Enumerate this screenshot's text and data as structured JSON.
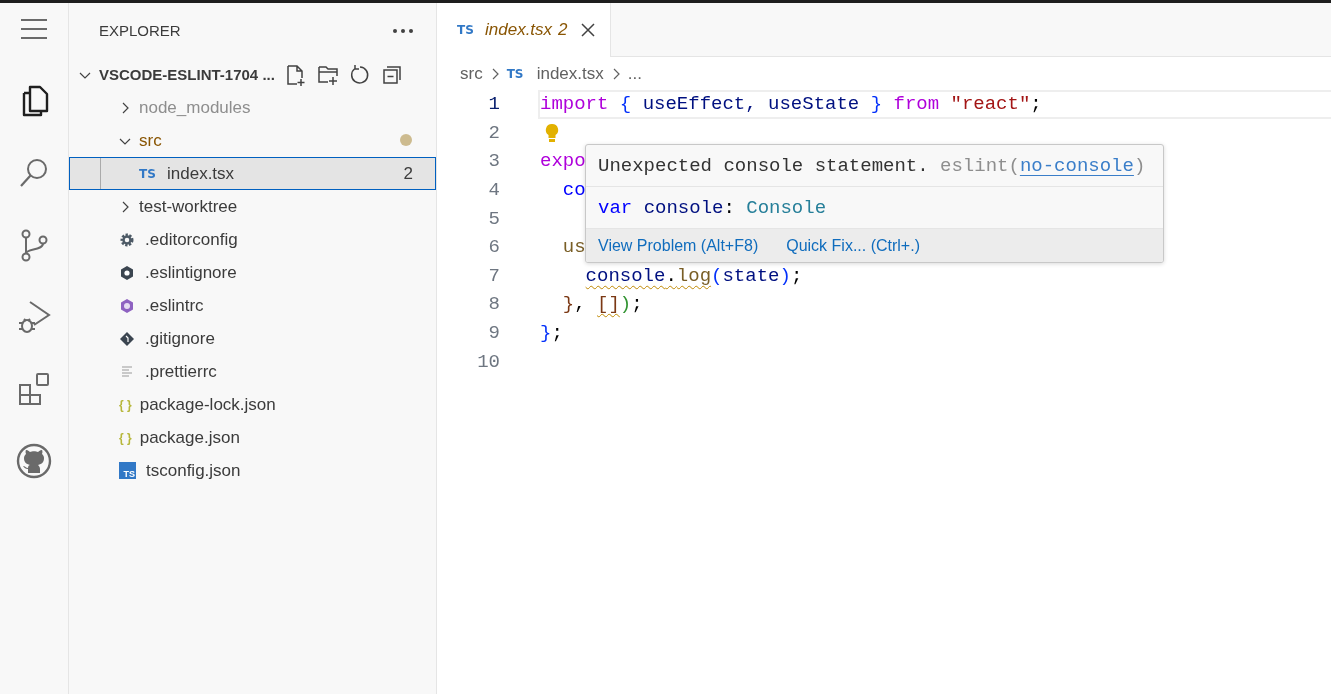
{
  "activity_bar": [
    {
      "kind": "menu",
      "selected": false
    },
    {
      "kind": "files",
      "selected": true
    },
    {
      "kind": "search",
      "selected": false
    },
    {
      "kind": "source-control",
      "selected": false
    },
    {
      "kind": "run-debug",
      "selected": false
    },
    {
      "kind": "extensions",
      "selected": false
    },
    {
      "kind": "github",
      "selected": false
    }
  ],
  "sidebar": {
    "title": "EXPLORER",
    "root": {
      "label": "VSCODE-ESLINT-1704 ...",
      "expanded": true,
      "children": [
        {
          "label": "node_modules",
          "kind": "folder",
          "expanded": false,
          "ignored": true,
          "modified": false,
          "selected": false
        },
        {
          "label": "src",
          "kind": "folder",
          "expanded": true,
          "ignored": false,
          "modified": true,
          "selected": false,
          "children": [
            {
              "label": "index.tsx",
              "kind": "ts",
              "icon_label": "TS",
              "problems": "2",
              "selected": true
            }
          ]
        },
        {
          "label": "test-worktree",
          "kind": "folder",
          "expanded": false,
          "ignored": false,
          "modified": false,
          "selected": false
        },
        {
          "label": ".editorconfig",
          "kind": "gear",
          "selected": false
        },
        {
          "label": ".eslintignore",
          "kind": "hexagon-dark",
          "selected": false
        },
        {
          "label": ".eslintrc",
          "kind": "hexagon-purple",
          "selected": false
        },
        {
          "label": ".gitignore",
          "kind": "diamond",
          "selected": false
        },
        {
          "label": ".prettierrc",
          "kind": "lines",
          "selected": false
        },
        {
          "label": "package-lock.json",
          "kind": "json",
          "icon_label": "{ }",
          "selected": false
        },
        {
          "label": "package.json",
          "kind": "json",
          "icon_label": "{ }",
          "selected": false
        },
        {
          "label": "tsconfig.json",
          "kind": "ts-box",
          "icon_label": "TS",
          "selected": false
        }
      ]
    }
  },
  "editor": {
    "tabs": [
      {
        "icon_label": "TS",
        "label": "index.tsx",
        "problems": "2",
        "selected": true,
        "preview": true
      }
    ],
    "breadcrumb": [
      {
        "label": "src"
      },
      {
        "icon_label": "TS",
        "label": "index.tsx"
      },
      {
        "label": "..."
      }
    ],
    "lines": [
      {
        "number": "1",
        "active": true,
        "tokens": [
          {
            "text": "import",
            "kind": "keyword"
          },
          {
            "text": " {",
            "kind": "brace"
          },
          {
            "text": " useEffect, useState",
            "kind": "variable"
          },
          {
            "text": " }",
            "kind": "brace"
          },
          {
            "text": " from",
            "kind": "keyword"
          },
          {
            "text": " \"react\"",
            "kind": "string"
          },
          {
            "text": ";",
            "kind": "plain"
          }
        ]
      },
      {
        "number": "2",
        "active": false,
        "lightbulb": true
      },
      {
        "number": "3",
        "active": false,
        "tokens": [
          {
            "text": "expo",
            "kind": "keyword"
          }
        ]
      },
      {
        "number": "4",
        "active": false,
        "tokens": [
          {
            "text": "  co",
            "kind": "storage"
          }
        ]
      },
      {
        "number": "5",
        "active": false
      },
      {
        "number": "6",
        "active": false,
        "tokens": [
          {
            "text": "  us",
            "kind": "function"
          }
        ]
      },
      {
        "number": "7",
        "active": false,
        "tokens": [
          {
            "text": "    console",
            "kind": "variable",
            "squiggle": true
          },
          {
            "text": ".",
            "kind": "plain",
            "squiggle": true
          },
          {
            "text": "log",
            "kind": "function",
            "squiggle": true
          },
          {
            "text": "(",
            "kind": "brace"
          },
          {
            "text": "state",
            "kind": "variable"
          },
          {
            "text": ")",
            "kind": "brace"
          },
          {
            "text": ";",
            "kind": "plain"
          }
        ]
      },
      {
        "number": "8",
        "active": false,
        "tokens": [
          {
            "text": "  }",
            "kind": "bracket3"
          },
          {
            "text": ",",
            "kind": "plain"
          },
          {
            "text": " []",
            "kind": "bracket3",
            "squiggle": true
          },
          {
            "text": ")",
            "kind": "bracket2"
          },
          {
            "text": ";",
            "kind": "plain"
          }
        ]
      },
      {
        "number": "9",
        "active": false,
        "tokens": [
          {
            "text": "}",
            "kind": "brace"
          },
          {
            "text": ";",
            "kind": "plain"
          }
        ]
      },
      {
        "number": "10",
        "active": false
      }
    ],
    "hover": {
      "message": "Unexpected console statement.",
      "source": "eslint(",
      "rule": "no-console",
      "source_end": ")",
      "signature": [
        {
          "text": "var",
          "kind": "storage"
        },
        {
          "text": " console",
          "kind": "variable"
        },
        {
          "text": ":",
          "kind": "plain"
        },
        {
          "text": " Console",
          "kind": "type"
        }
      ],
      "actions": [
        "View Problem (Alt+F8)",
        "Quick Fix... (Ctrl+.)"
      ]
    }
  }
}
